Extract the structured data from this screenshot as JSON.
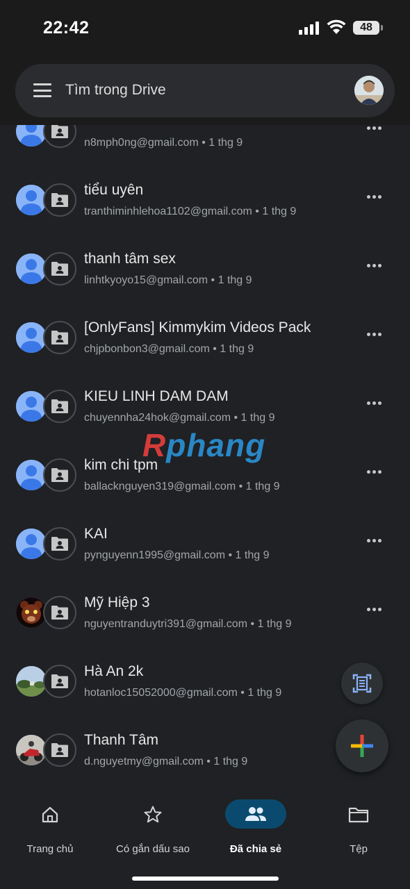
{
  "status": {
    "time": "22:42",
    "battery": "48"
  },
  "search": {
    "placeholder": "Tìm trong Drive"
  },
  "items": [
    {
      "title": "",
      "email": "n8mph0ng@gmail.com",
      "date": "1 thg 9",
      "avatar": "default"
    },
    {
      "title": "tiểu uyên",
      "email": "tranthiminhlehoa1102@gmail.com",
      "date": "1 thg 9",
      "avatar": "default"
    },
    {
      "title": "thanh tâm sex",
      "email": "linhtkyoyo15@gmail.com",
      "date": "1 thg 9",
      "avatar": "default"
    },
    {
      "title": "[OnlyFans] Kimmykim Videos Pack",
      "email": "chjpbonbon3@gmail.com",
      "date": "1 thg 9",
      "avatar": "default"
    },
    {
      "title": "KIEU LINH DAM DAM",
      "email": "chuyennha24hok@gmail.com",
      "date": "1 thg 9",
      "avatar": "default"
    },
    {
      "title": "kim chi tpm",
      "email": "ballacknguyen319@gmail.com",
      "date": "1 thg 9",
      "avatar": "default"
    },
    {
      "title": "KAI",
      "email": "pynguyenn1995@gmail.com",
      "date": "1 thg 9",
      "avatar": "default"
    },
    {
      "title": "Mỹ Hiệp 3",
      "email": "nguyentranduytri391@gmail.com",
      "date": "1 thg 9",
      "avatar": "photo-bear"
    },
    {
      "title": "Hà An 2k",
      "email": "hotanloc15052000@gmail.com",
      "date": "1 thg 9",
      "avatar": "photo-landscape"
    },
    {
      "title": "Thanh Tâm",
      "email": "d.nguyetmy@gmail.com",
      "date": "1 thg 9",
      "avatar": "photo-motorbike"
    }
  ],
  "watermark": {
    "r": "R",
    "rest": "phang"
  },
  "nav": [
    {
      "label": "Trang chủ",
      "icon": "home-icon",
      "active": false
    },
    {
      "label": "Có gắn dấu sao",
      "icon": "star-icon",
      "active": false
    },
    {
      "label": "Đã chia sẻ",
      "icon": "people-icon",
      "active": true
    },
    {
      "label": "Tệp",
      "icon": "folder-icon",
      "active": false
    }
  ],
  "colors": {
    "accent_pill": "#0b4a6f",
    "avatar_default": "#8ab4f8",
    "background": "#1f2124"
  }
}
